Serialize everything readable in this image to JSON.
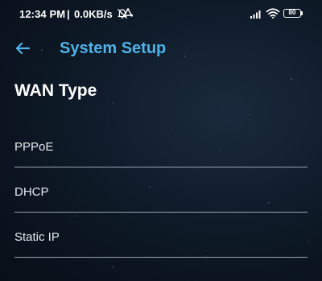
{
  "status_bar": {
    "time": "12:34 PM",
    "separator": "|",
    "speed": "0.0KB/s",
    "battery": "80",
    "icons": [
      "alarm-off-icon",
      "sync-icon",
      "signal-icon",
      "wifi-icon",
      "battery-icon"
    ]
  },
  "app_bar": {
    "back_icon": "arrow-left-icon",
    "title": "System Setup"
  },
  "section": {
    "title": "WAN Type"
  },
  "options": [
    {
      "label": "PPPoE"
    },
    {
      "label": "DHCP"
    },
    {
      "label": "Static IP"
    }
  ],
  "colors": {
    "accent": "#4fb2e8",
    "background": "#0f1b29",
    "divider": "#c8d2de"
  }
}
